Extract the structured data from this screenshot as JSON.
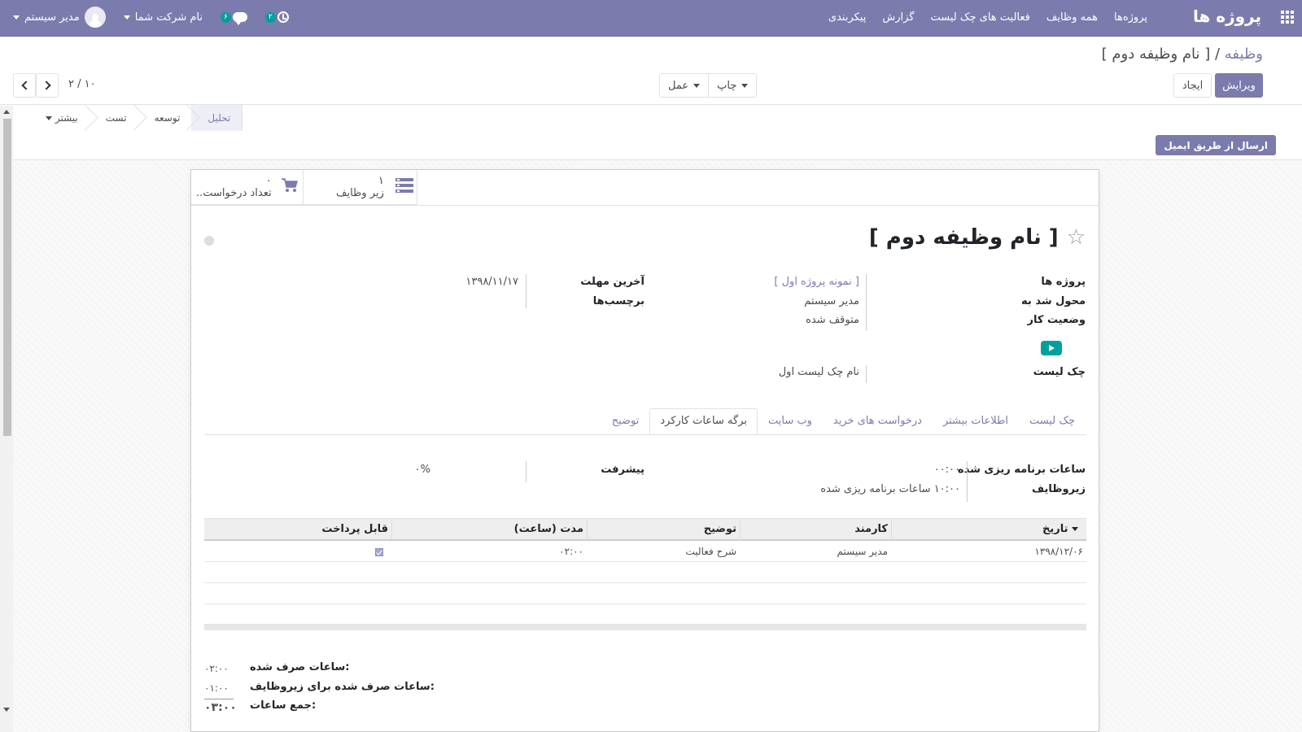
{
  "navbar": {
    "brand": "پروژه ها",
    "menu": [
      "پروژه‌ها",
      "همه وظایف",
      "فعالیت های چک لیست",
      "گزارش",
      "پیکربندی"
    ],
    "activity_count": "۲",
    "message_count": "۶",
    "company": "نام شرکت شما",
    "user": "مدیر سیستم",
    "accent": "#7c7bad"
  },
  "breadcrumb": {
    "parent": "وظیفه",
    "separator": " / ",
    "current": "[ نام وظیفه دوم ]"
  },
  "actions": {
    "edit": "ویرایش",
    "create": "ایجاد",
    "print": "چاپ",
    "action": "عمل"
  },
  "pager": {
    "value": "۲ / ۱۰"
  },
  "stages": [
    "تحلیل",
    "توسعه",
    "تست"
  ],
  "stages_more": "بیشتر",
  "mail_button": "ارسال از طریق ایمیل",
  "smart_buttons": {
    "subtasks": {
      "count": "۱",
      "label": "زیر وظایف"
    },
    "requests": {
      "count": "۰",
      "label": "تعداد درخواست.."
    }
  },
  "task": {
    "title": "[ نام وظیفه دوم ]",
    "fields": {
      "project_label": "پروژه ها",
      "project_value": "[ نمونه پروژه اول ]",
      "assigned_label": "محول شد به",
      "assigned_value": "مدیر سیستم",
      "status_label": "وضعیت کار",
      "status_value": "متوقف شده",
      "deadline_label": "آخرین مهلت",
      "deadline_value": "۱۳۹۸/۱۱/۱۷",
      "tags_label": "برچسب‌ها",
      "checklist_label": "چک لیست",
      "checklist_value": "نام چک لیست اول"
    }
  },
  "tabs": [
    "توضیح",
    "برگه ساعات کارکرد",
    "وب سایت",
    "درخواست های خرید",
    "اطلاعات بیشتر",
    "چک لیست"
  ],
  "timesheet": {
    "planned_label": "ساعات برنامه ریزی شده",
    "planned_value": "۰۰:۰۰",
    "subtasks_label": "زیروظایف",
    "subtasks_value": "۱۰:۰۰ ساعات برنامه ریزی شده",
    "progress_label": "پیشرفت",
    "progress_value": "۰%",
    "columns": [
      "تاریخ",
      "کارمند",
      "توضیح",
      "مدت (ساعت)",
      "قابل پرداخت"
    ],
    "rows": [
      {
        "date": "۱۳۹۸/۱۲/۰۶",
        "employee": "مدیر سیستم",
        "description": "شرح فعالیت",
        "duration": "۰۲:۰۰",
        "billable": true
      }
    ],
    "summary": [
      {
        "label": "ساعات صرف شده:",
        "value": "۰۲:۰۰"
      },
      {
        "label": "ساعات صرف شده برای زیروظایف:",
        "value": "۰۱:۰۰"
      },
      {
        "label": "جمع ساعات:",
        "value": "۰۳:۰۰"
      }
    ]
  }
}
